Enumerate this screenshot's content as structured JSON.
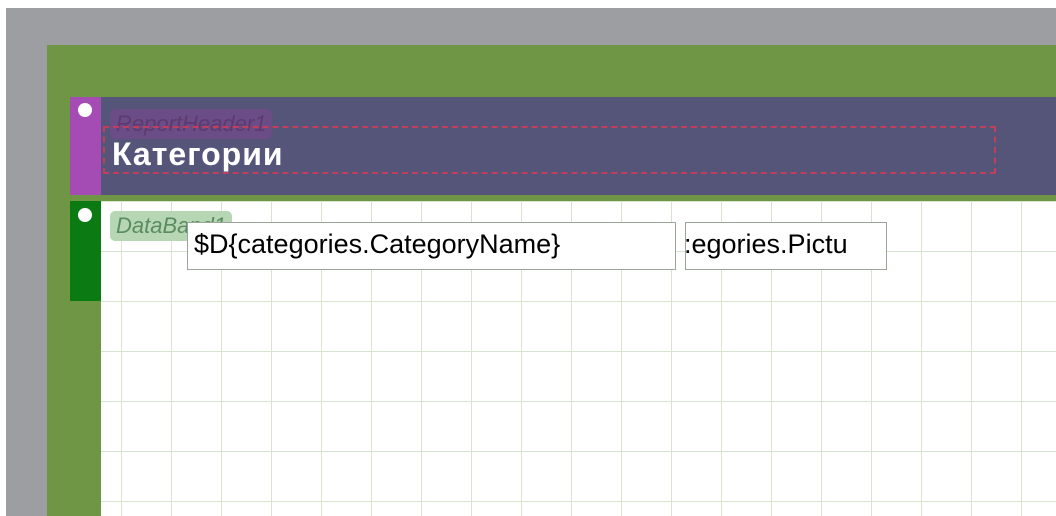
{
  "report_header": {
    "band_label": "ReportHeader1",
    "title": "Категории"
  },
  "data_band": {
    "band_label": "DataBand1",
    "fields": [
      {
        "text": "$D{categories.CategoryName}"
      },
      {
        "text": ":egories.Pictu"
      }
    ]
  },
  "colors": {
    "workspace": "#9d9ea2",
    "page": "#6f9645",
    "header_band": "#555579",
    "header_strip": "#a44bb4",
    "data_strip": "#0c7a12",
    "selection_border": "#c23e5c"
  }
}
